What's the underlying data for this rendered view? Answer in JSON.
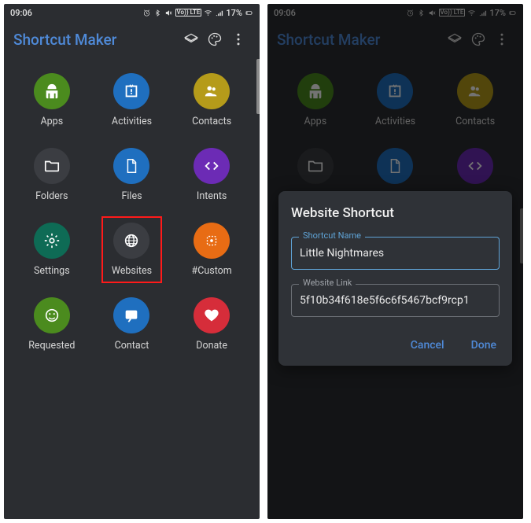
{
  "status": {
    "time": "09:06",
    "battery": "17%",
    "net_badge": "Vo)) LTE"
  },
  "appbar": {
    "title": "Shortcut Maker"
  },
  "tiles": [
    {
      "label": "Apps",
      "color": "#4b8b1e",
      "icon": "android"
    },
    {
      "label": "Activities",
      "color": "#1f6fbf",
      "icon": "activity"
    },
    {
      "label": "Contacts",
      "color": "#b59b1a",
      "icon": "contacts"
    },
    {
      "label": "Folders",
      "color": "#3b3d42",
      "icon": "folder"
    },
    {
      "label": "Files",
      "color": "#1f6fbf",
      "icon": "file"
    },
    {
      "label": "Intents",
      "color": "#6c2bb5",
      "icon": "code"
    },
    {
      "label": "Settings",
      "color": "#0e6b55",
      "icon": "gear"
    },
    {
      "label": "Websites",
      "color": "#3b3d42",
      "icon": "globe",
      "highlighted": true
    },
    {
      "label": "#Custom",
      "color": "#e86c14",
      "icon": "custom"
    },
    {
      "label": "Requested",
      "color": "#4b8b1e",
      "icon": "face"
    },
    {
      "label": "Contact",
      "color": "#1f6fbf",
      "icon": "chat"
    },
    {
      "label": "Donate",
      "color": "#d62d3a",
      "icon": "heart"
    }
  ],
  "dialog": {
    "title": "Website Shortcut",
    "fields": {
      "name": {
        "label": "Shortcut Name",
        "value": "Little Nightmares"
      },
      "link": {
        "label": "Website Link",
        "value": "5f10b34f618e5f6c6f5467bcf9rcp1"
      }
    },
    "actions": {
      "cancel": "Cancel",
      "done": "Done"
    }
  }
}
